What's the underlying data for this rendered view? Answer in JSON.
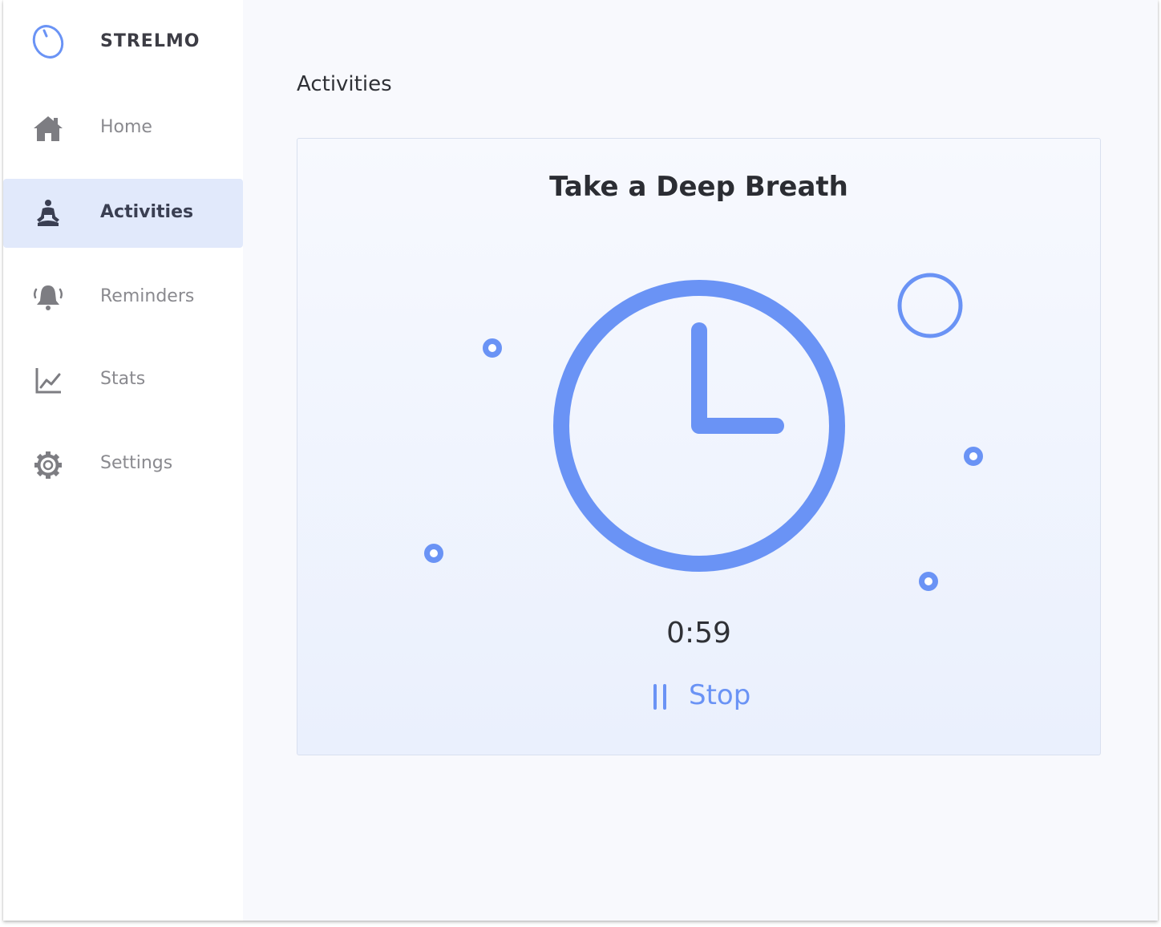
{
  "app": {
    "name": "STRELMO",
    "logo_icon": "stopwatch-logo-icon",
    "accent_color": "#6a93f5"
  },
  "sidebar": {
    "items": [
      {
        "label": "Home",
        "icon": "home-icon",
        "active": false
      },
      {
        "label": "Activities",
        "icon": "meditation-icon",
        "active": true
      },
      {
        "label": "Reminders",
        "icon": "bell-icon",
        "active": false
      },
      {
        "label": "Stats",
        "icon": "chart-line-icon",
        "active": false
      },
      {
        "label": "Settings",
        "icon": "gear-icon",
        "active": false
      }
    ]
  },
  "main": {
    "title": "Activities",
    "card": {
      "title": "Take a Deep Breath",
      "animation_icon": "clock-icon",
      "timer": "0:59",
      "stop_button": {
        "label": "Stop",
        "icon": "pause-icon"
      }
    }
  }
}
